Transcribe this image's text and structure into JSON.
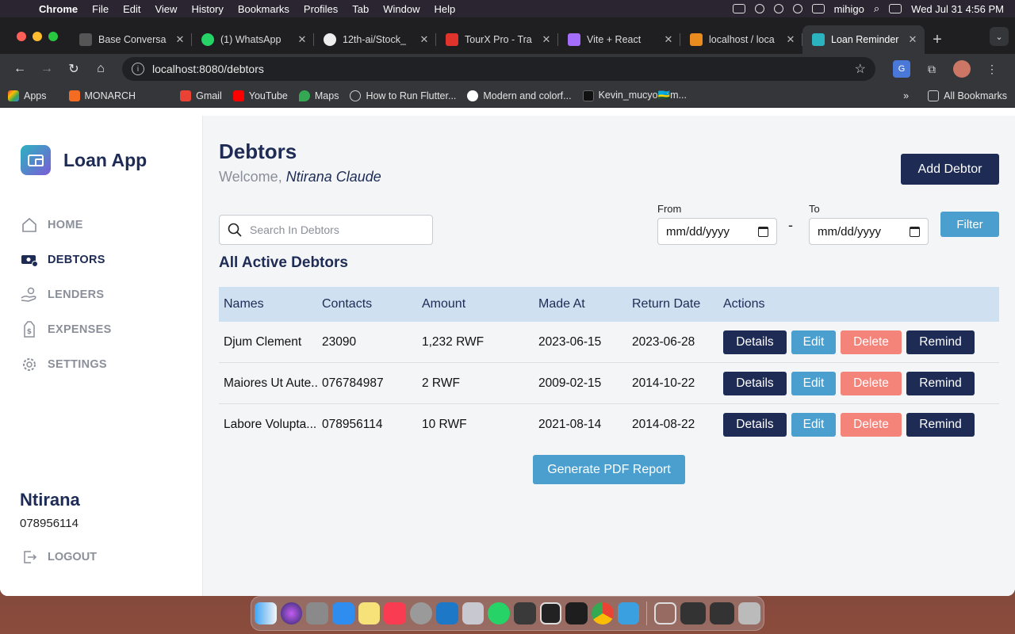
{
  "menubar": {
    "app": "Chrome",
    "items": [
      "File",
      "Edit",
      "View",
      "History",
      "Bookmarks",
      "Profiles",
      "Tab",
      "Window",
      "Help"
    ],
    "user": "mihigo",
    "datetime": "Wed Jul 31  4:56 PM"
  },
  "tabs": [
    {
      "label": "Base Conversa",
      "color": "#444"
    },
    {
      "label": "(1) WhatsApp",
      "color": "#25d366"
    },
    {
      "label": "12th-ai/Stock_",
      "color": "#eee"
    },
    {
      "label": "TourX Pro - Tra",
      "color": "#e0332c"
    },
    {
      "label": "Vite + React",
      "color": "#a56dfc"
    },
    {
      "label": "localhost / loca",
      "color": "#e98b1f"
    },
    {
      "label": "Loan Reminder",
      "color": "#2bb3c0"
    }
  ],
  "url": "localhost:8080/debtors",
  "bookmarks": [
    "Apps",
    "MONARCH",
    "Gmail",
    "YouTube",
    "Maps",
    "How to Run Flutter...",
    "Modern and colorf...",
    "Kevin_mucyo🇷🇼m...",
    "All Bookmarks"
  ],
  "app": {
    "brand": "Loan App",
    "nav": [
      {
        "label": "HOME",
        "icon": "home-icon"
      },
      {
        "label": "DEBTORS",
        "icon": "money-icon"
      },
      {
        "label": "LENDERS",
        "icon": "hand-money-icon"
      },
      {
        "label": "EXPENSES",
        "icon": "dollar-icon"
      },
      {
        "label": "SETTINGS",
        "icon": "gear-icon"
      }
    ],
    "user_name": "Ntirana",
    "user_phone": "078956114",
    "logout": "LOGOUT"
  },
  "page": {
    "title": "Debtors",
    "welcome": "Welcome,",
    "welcome_name": "Ntirana Claude",
    "add_button": "Add Debtor",
    "search_placeholder": "Search In Debtors",
    "from_label": "From",
    "to_label": "To",
    "date_placeholder": "mm/dd/yyyy",
    "dash": "-",
    "filter_button": "Filter",
    "subheading": "All Active Debtors",
    "columns": [
      "Names",
      "Contacts",
      "Amount",
      "Made At",
      "Return Date",
      "Actions"
    ],
    "rows": [
      {
        "name": "Djum Clement",
        "contact": "23090",
        "amount": "1,232 RWF",
        "made": "2023-06-15",
        "ret": "2023-06-28"
      },
      {
        "name": "Maiores Ut Aute...",
        "contact": "076784987",
        "amount": "2 RWF",
        "made": "2009-02-15",
        "ret": "2014-10-22"
      },
      {
        "name": "Labore Volupta...",
        "contact": "078956114",
        "amount": "10 RWF",
        "made": "2021-08-14",
        "ret": "2014-08-22"
      }
    ],
    "actions": {
      "details": "Details",
      "edit": "Edit",
      "delete": "Delete",
      "remind": "Remind"
    },
    "pdf_button": "Generate PDF Report"
  },
  "colors": {
    "navy": "#1d2b55",
    "blue": "#4a9fce",
    "salmon": "#f4837a",
    "header_bg": "#cfe1f0"
  }
}
